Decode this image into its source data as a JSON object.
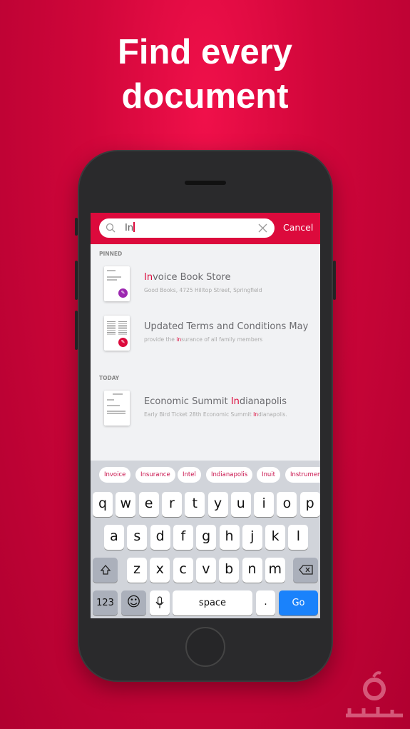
{
  "headline": {
    "line1": "Find every",
    "line2": "document"
  },
  "search": {
    "query": "In",
    "cancel_label": "Cancel"
  },
  "sections": [
    {
      "label": "PINNED",
      "items": [
        {
          "title_hl": "In",
          "title_rest": "voice Book Store",
          "sub_pre": "Good Books, 4725 Hilltop Street, Springfield",
          "sub_hl": "",
          "sub_post": "",
          "badge_color": "#9c27b0"
        },
        {
          "title_pre": "Updated Terms and Conditions May",
          "sub_pre": "provide the ",
          "sub_hl": "in",
          "sub_post": "surance of all family members",
          "badge_color": "#dc0a3c"
        }
      ]
    },
    {
      "label": "TODAY",
      "items": [
        {
          "title_pre": "Economic Summit ",
          "title_hl": "In",
          "title_rest": "dianapolis",
          "sub_pre": "Early Bird Ticket 28th Economic Summit ",
          "sub_hl": "In",
          "sub_post": "dianapolis."
        }
      ]
    }
  ],
  "suggestions": [
    "Invoice",
    "Insurance",
    "Intel",
    "Indianapolis",
    "Inuit",
    "Instrumen"
  ],
  "keyboard": {
    "row1": [
      "q",
      "w",
      "e",
      "r",
      "t",
      "y",
      "u",
      "i",
      "o",
      "p"
    ],
    "row2": [
      "a",
      "s",
      "d",
      "f",
      "g",
      "h",
      "j",
      "k",
      "l"
    ],
    "row3": [
      "z",
      "x",
      "c",
      "v",
      "b",
      "n",
      "m"
    ],
    "numbers": "123",
    "space": "space",
    "period": ".",
    "go": "Go"
  },
  "colors": {
    "accent": "#dc0a3c",
    "go": "#1a82fb"
  }
}
